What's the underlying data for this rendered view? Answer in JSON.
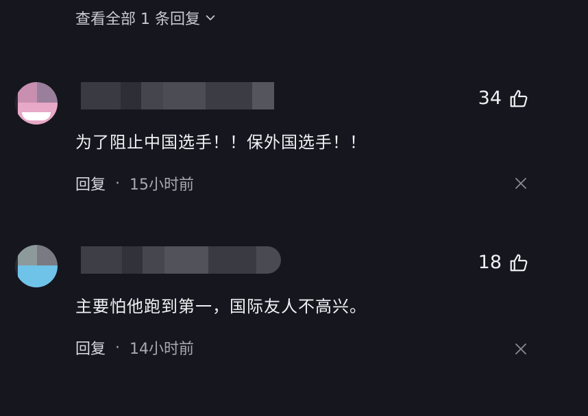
{
  "header": {
    "view_all_label": "查看全部 1 条回复"
  },
  "comments": [
    {
      "content": "为了阻止中国选手！！保外国选手！！",
      "likes": "34",
      "reply_label": "回复",
      "separator": "·",
      "time": "15小时前",
      "avatar_color": "#e8a8c8"
    },
    {
      "content": "主要怕他跑到第一，国际友人不高兴。",
      "likes": "18",
      "reply_label": "回复",
      "separator": "·",
      "time": "14小时前",
      "avatar_color": "#6fc3e8"
    }
  ],
  "icons": {
    "chevron": "chevron-down-icon",
    "like": "thumbs-up-icon",
    "close": "close-icon"
  }
}
